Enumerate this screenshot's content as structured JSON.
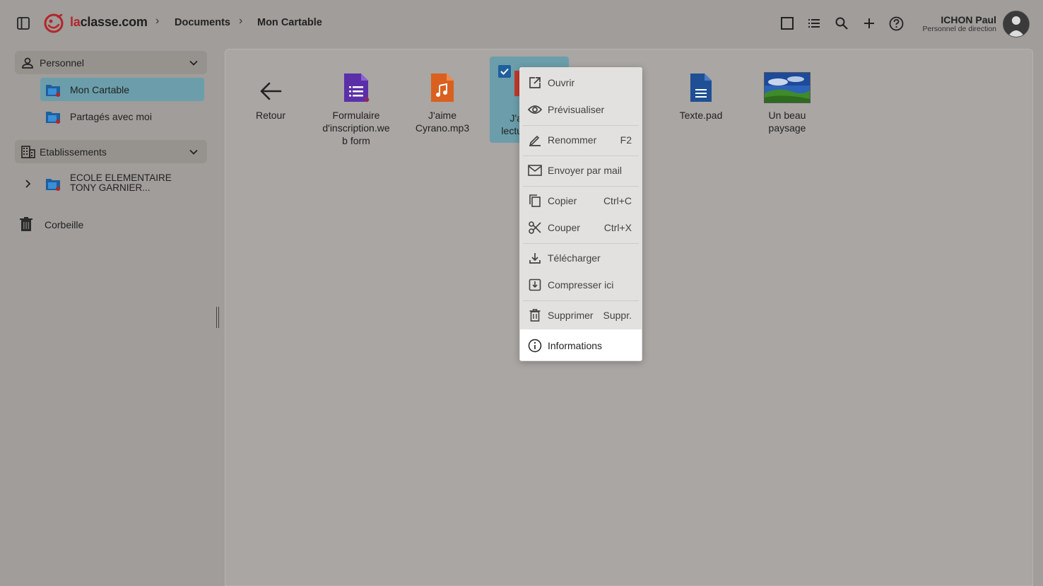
{
  "header": {
    "app_name_accent": "la",
    "app_name_rest": "classe.com",
    "breadcrumbs": [
      "Documents",
      "Mon Cartable"
    ],
    "user_name": "ICHON Paul",
    "user_role": "Personnel de direction"
  },
  "sidebar": {
    "personnel": {
      "title": "Personnel",
      "items": [
        {
          "label": "Mon Cartable",
          "active": true
        },
        {
          "label": "Partagés avec moi",
          "active": false
        }
      ]
    },
    "etablissements": {
      "title": "Etablissements",
      "items": [
        {
          "label_line1": "ECOLE ELEMENTAIRE",
          "label_line2": "TONY GARNIER..."
        }
      ]
    },
    "trash": "Corbeille"
  },
  "files": [
    {
      "name": "Retour",
      "icon": "arrow-left-icon"
    },
    {
      "name": "Formulaire d'inscription.web form",
      "icon": "form-icon",
      "color": "#5b2fa8"
    },
    {
      "name": "J'aime Cyrano.mp3",
      "icon": "audio-icon",
      "color": "#d9601f"
    },
    {
      "name": "J'a lectu",
      "icon": "pdf-icon",
      "color": "#c0392b",
      "selected": true
    },
    {
      "name": "Texte.pad",
      "icon": "document-icon",
      "color": "#1f4f94"
    },
    {
      "name": "Un beau paysage",
      "icon": "image-icon"
    }
  ],
  "context_menu": {
    "open": "Ouvrir",
    "preview": "Prévisualiser",
    "rename": "Renommer",
    "rename_shortcut": "F2",
    "mail": "Envoyer par mail",
    "copy": "Copier",
    "copy_shortcut": "Ctrl+C",
    "cut": "Couper",
    "cut_shortcut": "Ctrl+X",
    "download": "Télécharger",
    "compress": "Compresser ici",
    "delete": "Supprimer",
    "delete_shortcut": "Suppr.",
    "info": "Informations"
  },
  "colors": {
    "brand": "#b3262b",
    "selection": "#6b9eaa",
    "overlay_bg": "#a09d9a"
  }
}
